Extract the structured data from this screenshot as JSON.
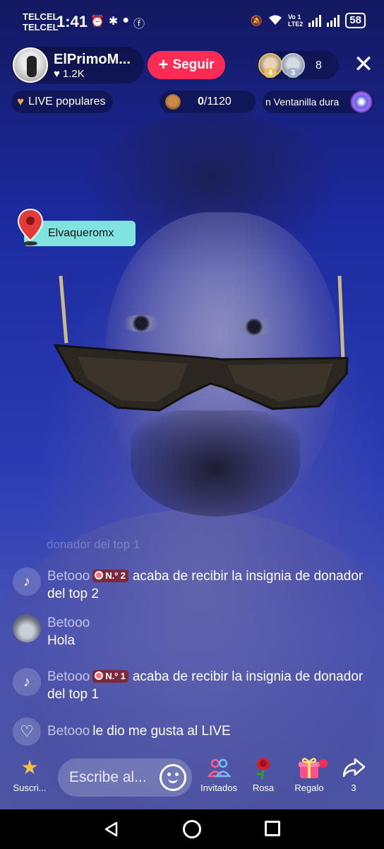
{
  "status_bar": {
    "carrier1": "TELCEL",
    "carrier2": "TELCEL",
    "time": "1:41",
    "network_label_top": "Vo",
    "network_label_bottom": "LTE2",
    "sim_top": "1",
    "battery": "58"
  },
  "host": {
    "name": "ElPrimoM...",
    "likes": "1.2K",
    "follow_label": "Seguir"
  },
  "viewers": {
    "top1_rank": "4",
    "top2_rank": "3",
    "count": "8"
  },
  "popular": {
    "label": "LIVE populares"
  },
  "goal": {
    "current": "0",
    "target": "/1120"
  },
  "ticker": {
    "text": "n Ventanilla dura"
  },
  "location_tag": {
    "label": "Elvaqueromx"
  },
  "chat": {
    "faded_text": "donador del top 1",
    "messages": [
      {
        "user": "Betooo",
        "badge": "N.º 2",
        "text": "acaba de recibir la insignia de donador del top 2"
      },
      {
        "user": "Betooo",
        "text": "Hola"
      },
      {
        "user": "Betooo",
        "badge": "N.º 1",
        "text": "acaba de recibir la insignia de donador del top 1"
      },
      {
        "user": "Betooo",
        "text": "le dio me gusta al LIVE"
      }
    ]
  },
  "bottom_bar": {
    "subscribe_label": "Suscri...",
    "input_placeholder": "Escribe al...",
    "guests_label": "Invitados",
    "rose_label": "Rosa",
    "gift_label": "Regalo",
    "share_count": "3"
  },
  "colors": {
    "follow_button": "#fe2c55",
    "location_tag": "#7fe3e0",
    "badge_bg": "#7a2a3a"
  }
}
